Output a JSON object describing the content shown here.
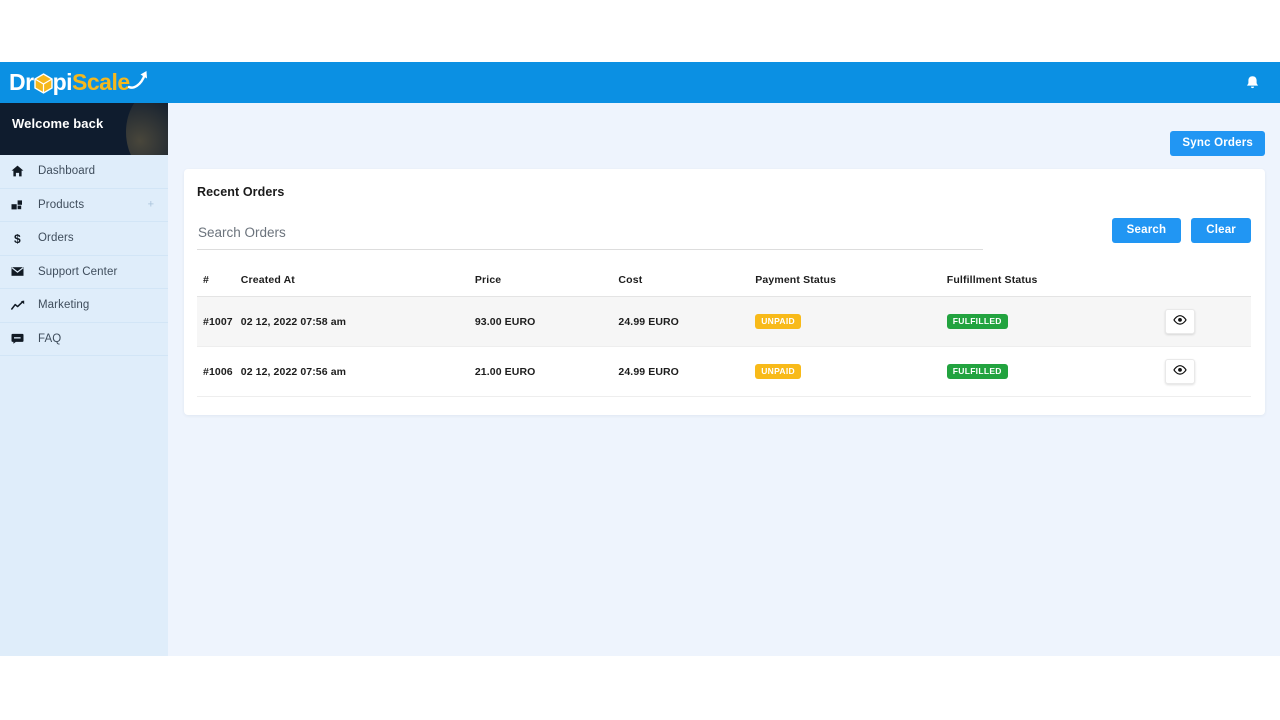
{
  "topbar": {
    "logo": {
      "part1": "Dr",
      "part2": "pi",
      "part3": "Scale",
      "box_icon": "hexagon-box-icon",
      "swoosh_icon": "arrow-swoosh-icon"
    },
    "bell_icon": "notification-bell-icon",
    "bg_color": "#0b90e3"
  },
  "sidebar": {
    "welcome": "Welcome back",
    "bg_color": "#dfedfa",
    "items": [
      {
        "label": "Dashboard",
        "icon": "home-icon",
        "expander": ""
      },
      {
        "label": "Products",
        "icon": "grid-squares-icon",
        "expander": "+"
      },
      {
        "label": "Orders",
        "icon": "dollar-icon",
        "expander": ""
      },
      {
        "label": "Support Center",
        "icon": "envelope-icon",
        "expander": ""
      },
      {
        "label": "Marketing",
        "icon": "trending-up-icon",
        "expander": ""
      },
      {
        "label": "FAQ",
        "icon": "chat-box-icon",
        "expander": ""
      }
    ]
  },
  "main": {
    "sync_label": "Sync Orders",
    "card_title": "Recent Orders",
    "search": {
      "placeholder": "Search Orders",
      "value": ""
    },
    "search_label": "Search",
    "clear_label": "Clear",
    "accent_color": "#2196f3",
    "table": {
      "columns": [
        "#",
        "Created At",
        "Price",
        "Cost",
        "Payment Status",
        "Fulfillment Status",
        ""
      ],
      "rows": [
        {
          "id": "#1007",
          "created_at": "02 12, 2022 07:58 am",
          "price": "93.00 EURO",
          "cost": "24.99 EURO",
          "payment_status": "UNPAID",
          "fulfillment_status": "FULFILLED",
          "action_icon": "eye-icon"
        },
        {
          "id": "#1006",
          "created_at": "02 12, 2022 07:56 am",
          "price": "21.00 EURO",
          "cost": "24.99 EURO",
          "payment_status": "UNPAID",
          "fulfillment_status": "FULFILLED",
          "action_icon": "eye-icon"
        }
      ]
    },
    "badge_colors": {
      "unpaid": "#f8ba19",
      "fulfilled": "#22a33f"
    }
  }
}
